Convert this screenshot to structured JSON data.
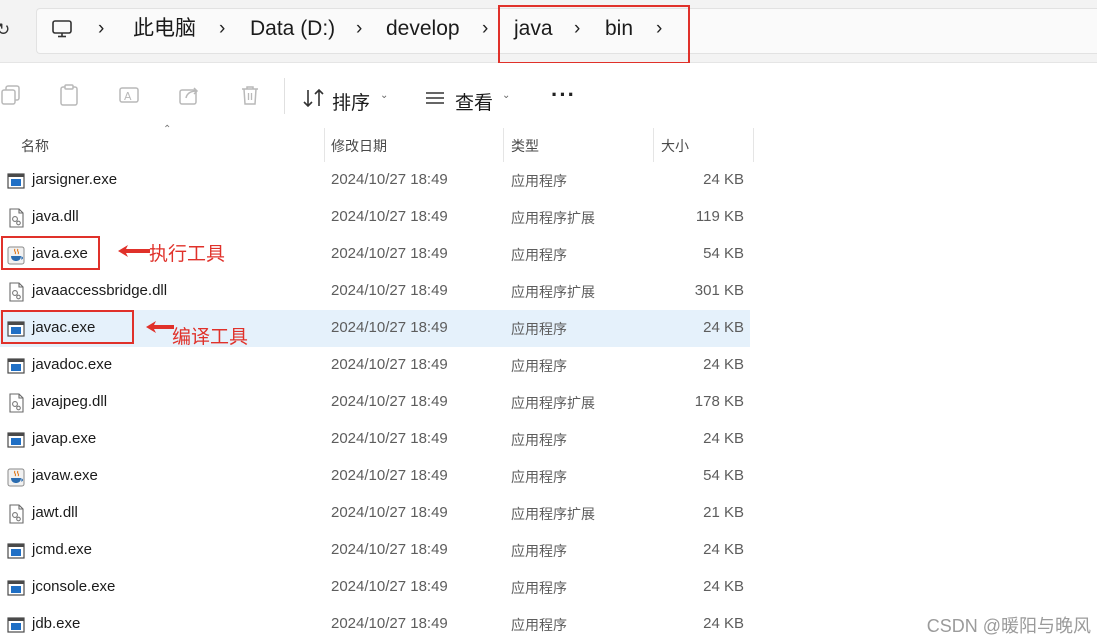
{
  "breadcrumb": {
    "items": [
      "此电脑",
      "Data (D:)",
      "develop",
      "java",
      "bin"
    ],
    "separator": "›"
  },
  "toolbar": {
    "sort_label": "排序",
    "view_label": "查看",
    "more_label": "···"
  },
  "columns": {
    "name": "名称",
    "modified": "修改日期",
    "type": "类型",
    "size": "大小"
  },
  "files": [
    {
      "name": "jarsigner.exe",
      "modified": "2024/10/27 18:49",
      "type": "应用程序",
      "size": "24 KB",
      "icon": "exe-window-icon"
    },
    {
      "name": "java.dll",
      "modified": "2024/10/27 18:49",
      "type": "应用程序扩展",
      "size": "119 KB",
      "icon": "dll-gear-icon"
    },
    {
      "name": "java.exe",
      "modified": "2024/10/27 18:49",
      "type": "应用程序",
      "size": "54 KB",
      "icon": "java-cup-icon"
    },
    {
      "name": "javaaccessbridge.dll",
      "modified": "2024/10/27 18:49",
      "type": "应用程序扩展",
      "size": "301 KB",
      "icon": "dll-gear-icon"
    },
    {
      "name": "javac.exe",
      "modified": "2024/10/27 18:49",
      "type": "应用程序",
      "size": "24 KB",
      "icon": "exe-window-icon"
    },
    {
      "name": "javadoc.exe",
      "modified": "2024/10/27 18:49",
      "type": "应用程序",
      "size": "24 KB",
      "icon": "exe-window-icon"
    },
    {
      "name": "javajpeg.dll",
      "modified": "2024/10/27 18:49",
      "type": "应用程序扩展",
      "size": "178 KB",
      "icon": "dll-gear-icon"
    },
    {
      "name": "javap.exe",
      "modified": "2024/10/27 18:49",
      "type": "应用程序",
      "size": "24 KB",
      "icon": "exe-window-icon"
    },
    {
      "name": "javaw.exe",
      "modified": "2024/10/27 18:49",
      "type": "应用程序",
      "size": "54 KB",
      "icon": "java-cup-icon"
    },
    {
      "name": "jawt.dll",
      "modified": "2024/10/27 18:49",
      "type": "应用程序扩展",
      "size": "21 KB",
      "icon": "dll-gear-icon"
    },
    {
      "name": "jcmd.exe",
      "modified": "2024/10/27 18:49",
      "type": "应用程序",
      "size": "24 KB",
      "icon": "exe-window-icon"
    },
    {
      "name": "jconsole.exe",
      "modified": "2024/10/27 18:49",
      "type": "应用程序",
      "size": "24 KB",
      "icon": "exe-window-icon"
    },
    {
      "name": "jdb.exe",
      "modified": "2024/10/27 18:49",
      "type": "应用程序",
      "size": "24 KB",
      "icon": "exe-window-icon"
    }
  ],
  "selected_file": "javac.exe",
  "annotations": {
    "java_exe": "执行工具",
    "javac_exe": "编译工具"
  },
  "watermark": "CSDN @暖阳与晚风",
  "colors": {
    "highlight": "#e0312a",
    "selection": "#e5f1fb",
    "exe_icon_blue": "#1f6fc5"
  }
}
